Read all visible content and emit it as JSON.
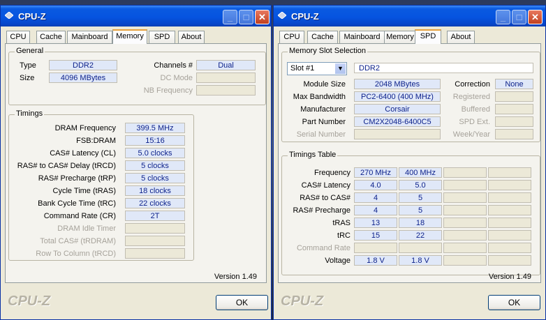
{
  "left": {
    "title": "CPU-Z",
    "tabs": [
      "CPU",
      "Cache",
      "Mainboard",
      "Memory",
      "SPD",
      "About"
    ],
    "active_tab": "Memory",
    "general": {
      "legend": "General",
      "type_label": "Type",
      "type_value": "DDR2",
      "size_label": "Size",
      "size_value": "4096 MBytes",
      "channels_label": "Channels #",
      "channels_value": "Dual",
      "dcmode_label": "DC Mode",
      "nbfreq_label": "NB Frequency"
    },
    "timings": {
      "legend": "Timings",
      "rows": [
        {
          "label": "DRAM Frequency",
          "value": "399.5 MHz"
        },
        {
          "label": "FSB:DRAM",
          "value": "15:16"
        },
        {
          "label": "CAS# Latency (CL)",
          "value": "5.0 clocks"
        },
        {
          "label": "RAS# to CAS# Delay (tRCD)",
          "value": "5 clocks"
        },
        {
          "label": "RAS# Precharge (tRP)",
          "value": "5 clocks"
        },
        {
          "label": "Cycle Time (tRAS)",
          "value": "18 clocks"
        },
        {
          "label": "Bank Cycle Time (tRC)",
          "value": "22 clocks"
        },
        {
          "label": "Command Rate (CR)",
          "value": "2T"
        },
        {
          "label": "DRAM Idle Timer",
          "value": ""
        },
        {
          "label": "Total CAS# (tRDRAM)",
          "value": ""
        },
        {
          "label": "Row To Column (tRCD)",
          "value": ""
        }
      ]
    },
    "version": "Version 1.49",
    "brand": "CPU-Z",
    "ok_label": "OK"
  },
  "right": {
    "title": "CPU-Z",
    "tabs": [
      "CPU",
      "Cache",
      "Mainboard",
      "Memory",
      "SPD",
      "About"
    ],
    "active_tab": "SPD",
    "slot": {
      "legend": "Memory Slot Selection",
      "selected": "Slot #1",
      "type": "DDR2",
      "module_size_label": "Module Size",
      "module_size": "2048 MBytes",
      "bandwidth_label": "Max Bandwidth",
      "bandwidth": "PC2-6400 (400 MHz)",
      "manufacturer_label": "Manufacturer",
      "manufacturer": "Corsair",
      "part_label": "Part Number",
      "part": "CM2X2048-6400C5",
      "serial_label": "Serial Number",
      "correction_label": "Correction",
      "correction": "None",
      "registered_label": "Registered",
      "buffered_label": "Buffered",
      "spdext_label": "SPD Ext.",
      "weekyear_label": "Week/Year"
    },
    "timings_table": {
      "legend": "Timings Table",
      "rows": [
        {
          "label": "Frequency",
          "v1": "270 MHz",
          "v2": "400 MHz"
        },
        {
          "label": "CAS# Latency",
          "v1": "4.0",
          "v2": "5.0"
        },
        {
          "label": "RAS# to CAS#",
          "v1": "4",
          "v2": "5"
        },
        {
          "label": "RAS# Precharge",
          "v1": "4",
          "v2": "5"
        },
        {
          "label": "tRAS",
          "v1": "13",
          "v2": "18"
        },
        {
          "label": "tRC",
          "v1": "15",
          "v2": "22"
        },
        {
          "label": "Command Rate",
          "v1": "",
          "v2": ""
        },
        {
          "label": "Voltage",
          "v1": "1.8 V",
          "v2": "1.8 V"
        }
      ]
    },
    "version": "Version 1.49",
    "brand": "CPU-Z",
    "ok_label": "OK"
  }
}
